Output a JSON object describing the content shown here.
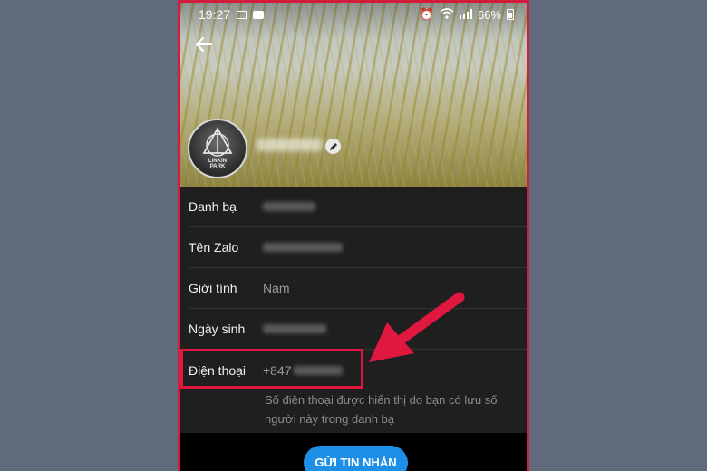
{
  "status_bar": {
    "time": "19:27",
    "battery": "66%"
  },
  "contact": {
    "fields": [
      {
        "label": "Danh bạ",
        "value": ""
      },
      {
        "label": "Tên Zalo",
        "value": ""
      },
      {
        "label": "Giới tính",
        "value": "Nam"
      },
      {
        "label": "Ngày sinh",
        "value": ""
      }
    ],
    "phone": {
      "label": "Điện thoại",
      "value": "+847"
    },
    "phone_note": "Số điện thoại được hiển thị do bạn có lưu số người này trong danh bạ"
  },
  "actions": {
    "send_message": "GỬI TIN NHẮN"
  },
  "avatar_text": {
    "line1": "LINKIN",
    "line2": "PARK"
  },
  "colors": {
    "highlight": "#e0173f",
    "button": "#1e8fe6",
    "page_bg": "#5f6b7b"
  }
}
